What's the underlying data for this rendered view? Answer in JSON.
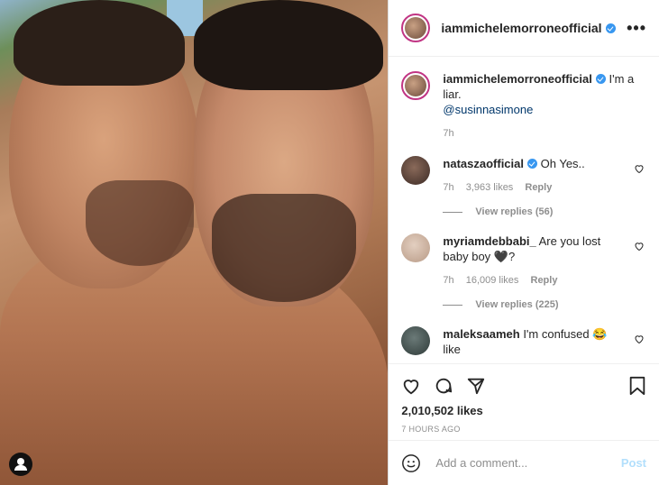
{
  "post": {
    "username": "iammichelemorroneofficial",
    "more_label": "•••",
    "caption": {
      "username": "iammichelemorroneofficial",
      "text": "I'm a liar.",
      "mention": "@susinnasimone",
      "time": "7h"
    },
    "comments": [
      {
        "username": "nataszaofficial",
        "verified": true,
        "text": "Oh Yes..",
        "time": "7h",
        "likes": "3,963 likes",
        "reply_label": "Reply",
        "view_replies": "View replies (56)",
        "avatar_color": "#3b2a24"
      },
      {
        "username": "myriamdebbabi_",
        "verified": false,
        "text": "Are you lost baby boy 🖤?",
        "time": "7h",
        "likes": "16,009 likes",
        "reply_label": "Reply",
        "view_replies": "View replies (225)",
        "avatar_color": "#b89a86"
      },
      {
        "username": "maleksaameh",
        "verified": false,
        "text": "I'm confused 😂 like",
        "avatar_color": "#2e3a38"
      }
    ],
    "likes_count": "2,010,502 likes",
    "time_ago": "7 HOURS AGO",
    "add_comment_placeholder": "Add a comment...",
    "post_label": "Post"
  },
  "colors": {
    "verified": "#3897f0",
    "post_button_disabled": "#b2dffc",
    "mention": "#00376b"
  }
}
